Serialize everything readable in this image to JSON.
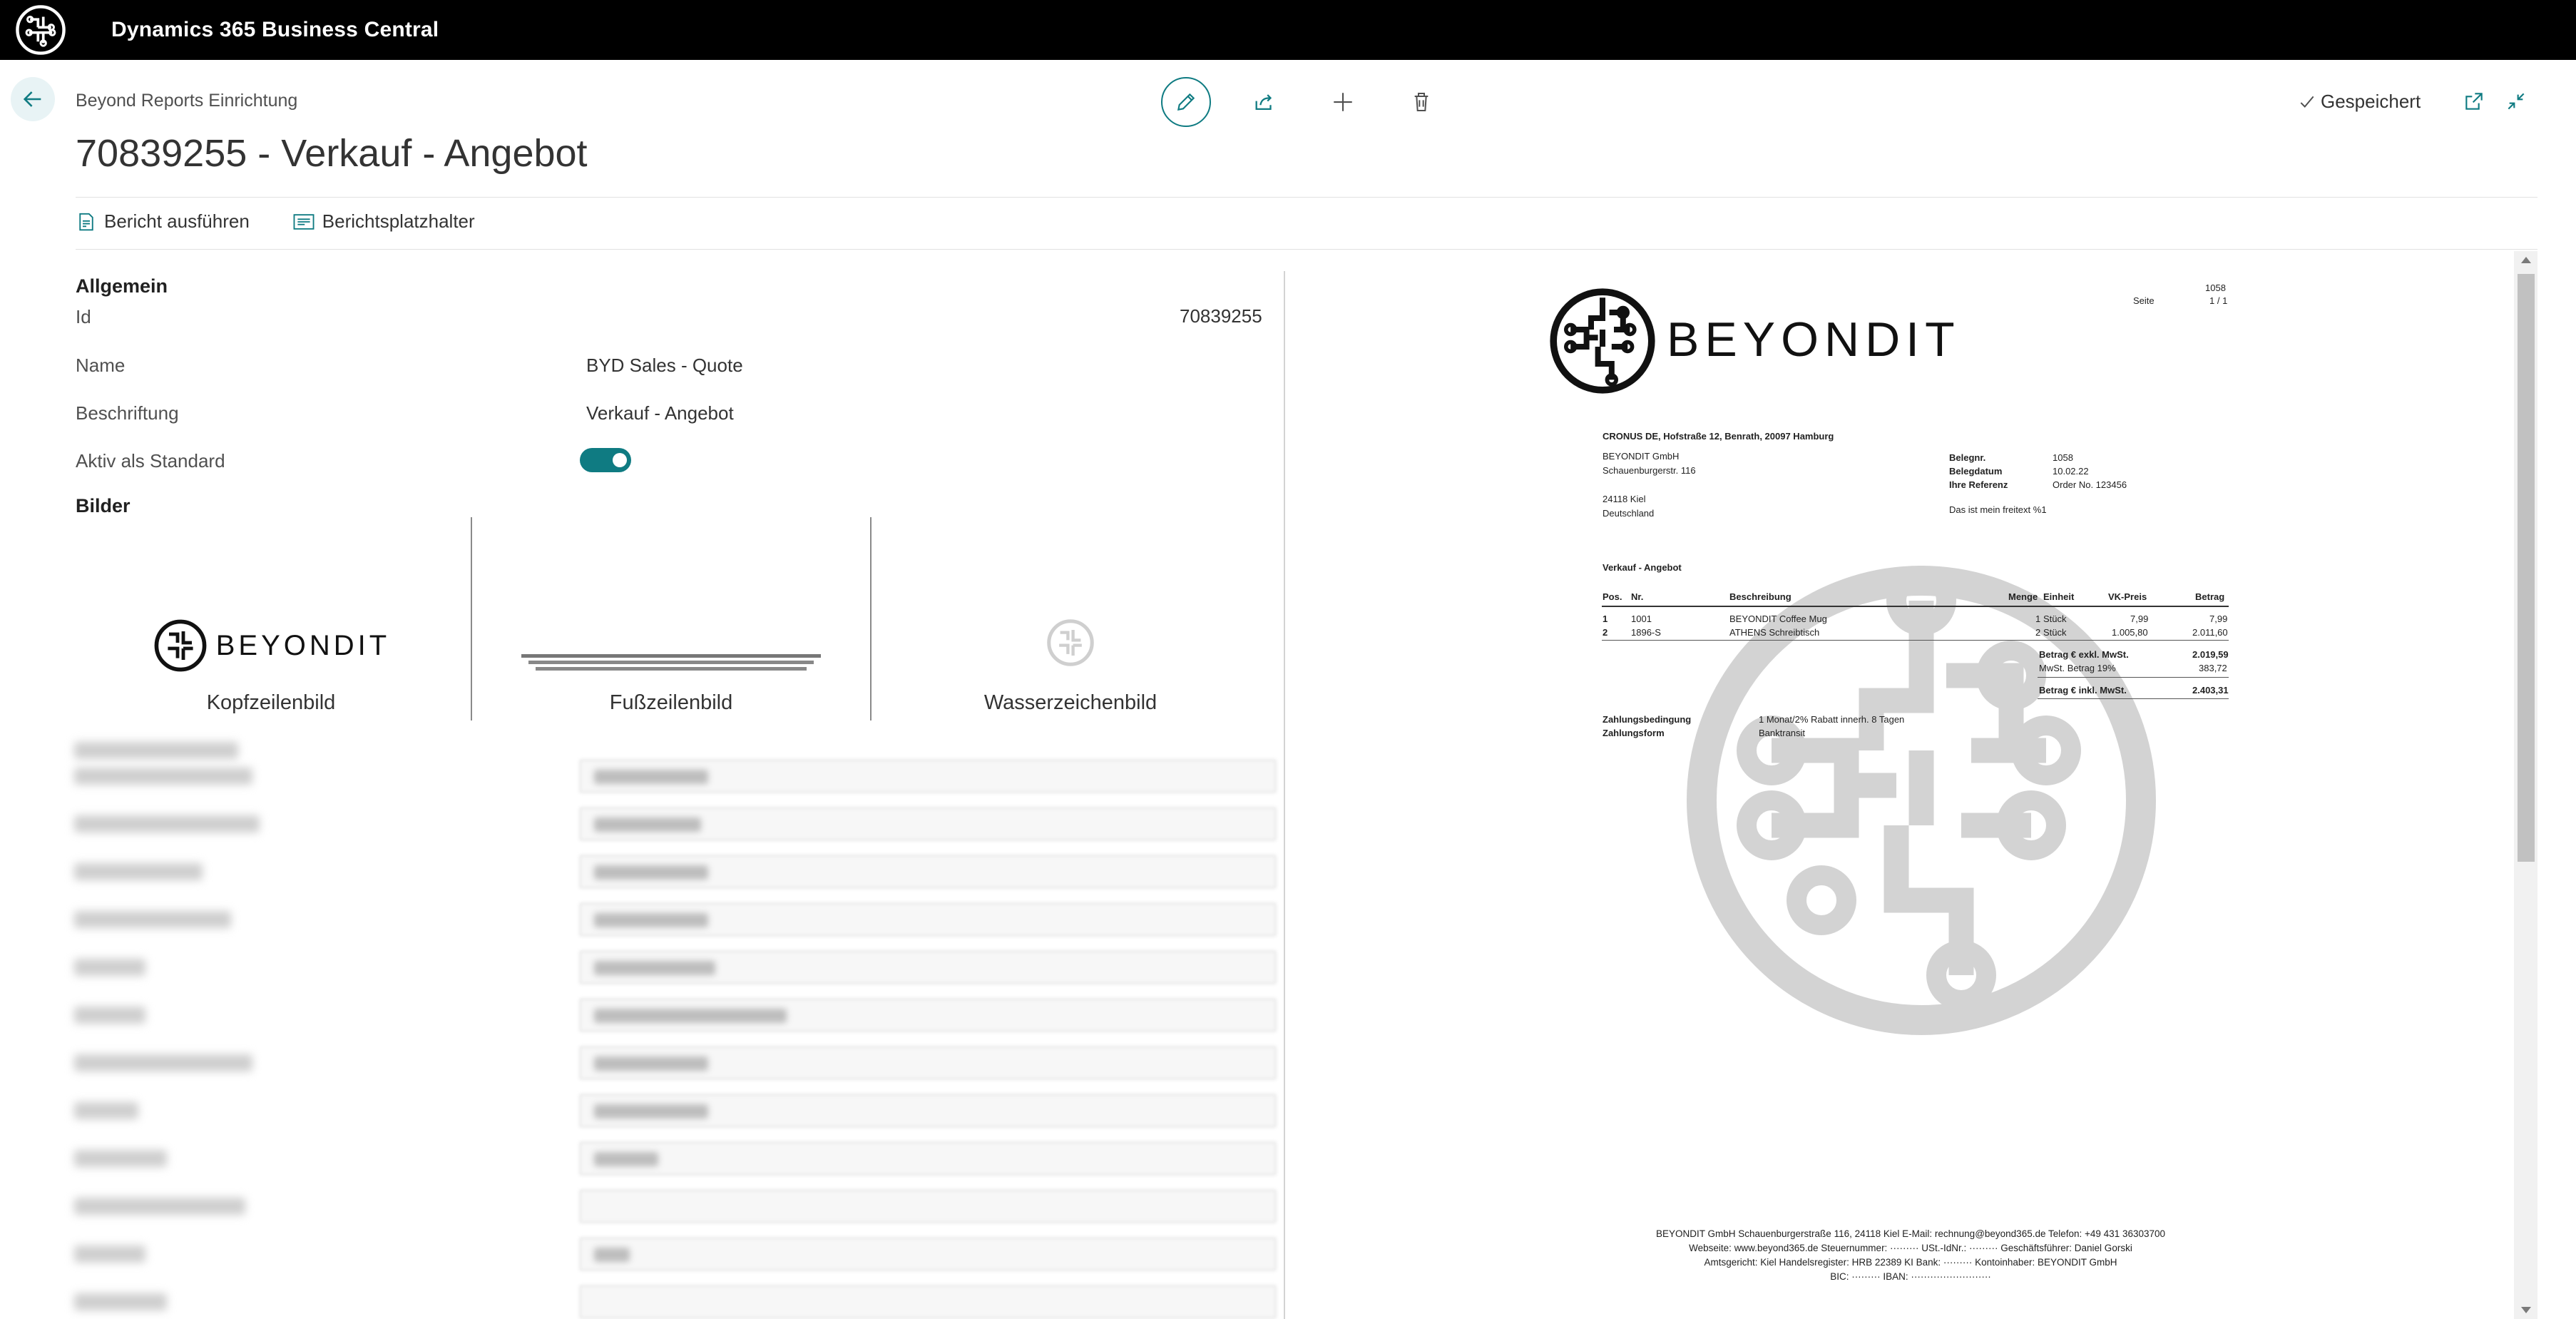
{
  "app": {
    "title": "Dynamics 365 Business Central"
  },
  "header": {
    "breadcrumb": "Beyond Reports Einrichtung",
    "title": "70839255 - Verkauf - Angebot",
    "saved_label": "Gespeichert"
  },
  "toolbar": {
    "run_report": "Bericht ausführen",
    "placeholders": "Berichtsplatzhalter"
  },
  "general": {
    "section": "Allgemein",
    "id_label": "Id",
    "id_value": "70839255",
    "name_label": "Name",
    "name_value": "BYD Sales - Quote",
    "caption_label": "Beschriftung",
    "caption_value": "Verkauf - Angebot",
    "default_label": "Aktiv als Standard",
    "default_on": true
  },
  "images": {
    "section": "Bilder",
    "header_caption": "Kopfzeilenbild",
    "footer_caption": "Fußzeilenbild",
    "watermark_caption": "Wasserzeichenbild",
    "logo_text": "BEYONDIT"
  },
  "preview": {
    "logo_text": "BEYONDIT",
    "doc_no_top": "1058",
    "page_label": "Seite",
    "page_value": "1 / 1",
    "sender_line": "CRONUS DE, Hofstraße 12, Benrath, 20097 Hamburg",
    "address": [
      "BEYONDIT GmbH",
      "Schauenburgerstr. 116",
      "",
      "24118 Kiel",
      "Deutschland"
    ],
    "info": [
      {
        "label": "Belegnr.",
        "value": "1058"
      },
      {
        "label": "Belegdatum",
        "value": "10.02.22"
      },
      {
        "label": "Ihre Referenz",
        "value": "Order No. 123456"
      }
    ],
    "freetext": "Das ist mein freitext %1",
    "doc_title": "Verkauf - Angebot",
    "table_headers": [
      "Pos.",
      "Nr.",
      "Beschreibung",
      "Menge",
      "Einheit",
      "VK-Preis",
      "Betrag"
    ],
    "lines": [
      [
        "1",
        "1001",
        "BEYONDIT Coffee Mug",
        "1",
        "Stück",
        "7,99",
        "7,99"
      ],
      [
        "2",
        "1896-S",
        "ATHENS Schreibtisch",
        "2",
        "Stück",
        "1.005,80",
        "2.011,60"
      ]
    ],
    "totals": [
      {
        "label": "Betrag € exkl. MwSt.",
        "value": "2.019,59",
        "bold": true
      },
      {
        "label": "MwSt. Betrag 19%",
        "value": "383,72",
        "bold": false
      },
      {
        "label": "Betrag € inkl. MwSt.",
        "value": "2.403,31",
        "bold": true
      }
    ],
    "payment_terms_label": "Zahlungsbedingung",
    "payment_terms_value": "1 Monat/2% Rabatt innerh. 8 Tagen",
    "payment_method_label": "Zahlungsform",
    "payment_method_value": "Banktransit",
    "footer_lines": [
      "BEYONDIT GmbH  Schauenburgerstraße 116, 24118 Kiel  E-Mail: rechnung@beyond365.de  Telefon: +49 431 36303700",
      "Webseite: www.beyond365.de  Steuernummer: ·········  USt.-IdNr.: ·········  Geschäftsführer: Daniel Gorski",
      "Amtsgericht: Kiel  Handelsregister: HRB 22389 KI  Bank: ·········  Kontoinhaber: BEYONDIT GmbH",
      "BIC: ·········  IBAN: ·························"
    ]
  },
  "colors": {
    "accent": "#0f7b82",
    "topbar": "#000000"
  },
  "icons": [
    "beyondit-logo-icon",
    "back-arrow-icon",
    "edit-icon",
    "share-icon",
    "add-icon",
    "delete-icon",
    "checkmark-icon",
    "open-new-window-icon",
    "collapse-icon",
    "run-report-icon",
    "placeholder-icon"
  ]
}
